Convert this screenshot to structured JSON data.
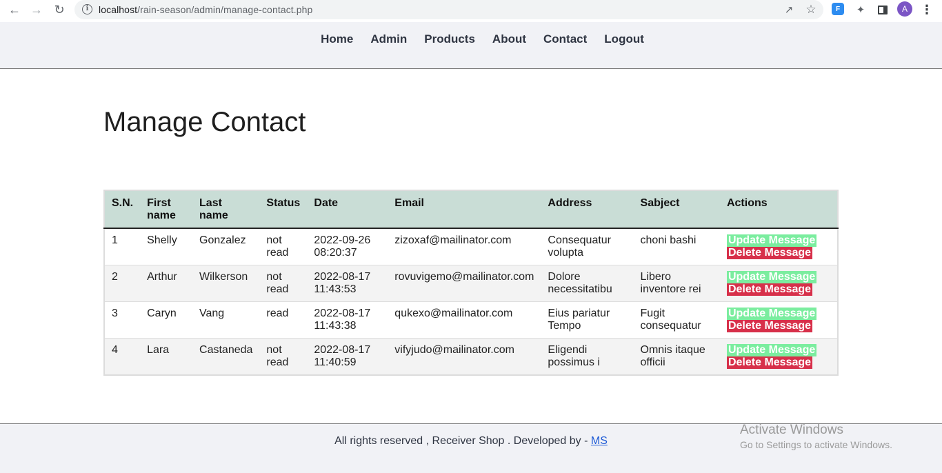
{
  "browser": {
    "url_host": "localhost",
    "url_path": "/rain-season/admin/manage-contact.php",
    "avatar_letter": "A",
    "ext_label": "F"
  },
  "nav": {
    "items": [
      "Home",
      "Admin",
      "Products",
      "About",
      "Contact",
      "Logout"
    ]
  },
  "page": {
    "title": "Manage Contact"
  },
  "table": {
    "headers": [
      "S.N.",
      "First name",
      "Last name",
      "Status",
      "Date",
      "Email",
      "Address",
      "Sabject",
      "Actions"
    ],
    "rows": [
      {
        "sn": "1",
        "first": "Shelly",
        "last": "Gonzalez",
        "status": "not read",
        "date": "2022-09-26 08:20:37",
        "email": "zizoxaf@mailinator.com",
        "address": "Consequatur volupta",
        "subject": "choni bashi",
        "update": "Update Message",
        "delete": "Delete Message"
      },
      {
        "sn": "2",
        "first": "Arthur",
        "last": "Wilkerson",
        "status": "not read",
        "date": "2022-08-17 11:43:53",
        "email": "rovuvigemo@mailinator.com",
        "address": "Dolore necessitatibu",
        "subject": "Libero inventore rei",
        "update": "Update Message",
        "delete": "Delete Message"
      },
      {
        "sn": "3",
        "first": "Caryn",
        "last": "Vang",
        "status": "read",
        "date": "2022-08-17 11:43:38",
        "email": "qukexo@mailinator.com",
        "address": "Eius pariatur Tempo",
        "subject": "Fugit consequatur",
        "update": "Update Message",
        "delete": "Delete Message"
      },
      {
        "sn": "4",
        "first": "Lara",
        "last": "Castaneda",
        "status": "not read",
        "date": "2022-08-17 11:40:59",
        "email": "vifyjudo@mailinator.com",
        "address": "Eligendi possimus i",
        "subject": "Omnis itaque officii",
        "update": "Update Message",
        "delete": "Delete Message"
      }
    ]
  },
  "footer": {
    "text": "All rights reserved , Receiver Shop . Developed by - ",
    "link": "MS"
  },
  "watermark": {
    "line1": "Activate Windows",
    "line2": "Go to Settings to activate Windows."
  },
  "colors": {
    "header_bg": "#f1f2f6",
    "table_head_bg": "#c9ddd6",
    "update_btn": "#7bed9f",
    "delete_btn": "#d7304a",
    "status_unread": "#e01b1b",
    "status_read": "#1a8a2a"
  }
}
